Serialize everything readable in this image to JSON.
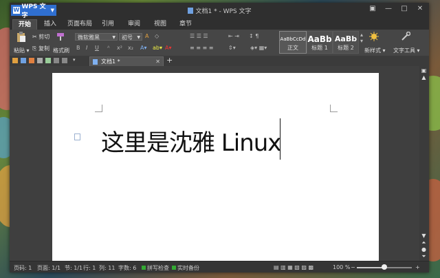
{
  "app": {
    "name": "WPS 文字",
    "window_title": "文档1 * - WPS 文字"
  },
  "tabs": [
    "开始",
    "插入",
    "页面布局",
    "引用",
    "审阅",
    "视图",
    "章节"
  ],
  "ribbon": {
    "paste": "粘贴",
    "cut": "剪切",
    "copy": "复制",
    "format_painter": "格式刷",
    "font_name": "微软雅黑",
    "font_size": "初号",
    "styles": [
      {
        "sample": "AaBbCcDd",
        "label": "正文"
      },
      {
        "sample": "AaBb",
        "label": "标题 1"
      },
      {
        "sample": "AaBb",
        "label": "标题 2"
      }
    ],
    "new_style": "新样式",
    "text_tools": "文字工具"
  },
  "doc_tab": {
    "title": "文档1 *"
  },
  "document": {
    "text": "这里是沈雅 Linux"
  },
  "status": {
    "page": "页码: 1",
    "pages": "页面: 1/1",
    "section": "节: 1/1",
    "line": "行: 1",
    "column": "列: 11",
    "word_count": "字数: 6",
    "spell_check": "拼写检查",
    "backup": "实时备份",
    "zoom": "100 %",
    "zoom_fraction": 0.5
  }
}
